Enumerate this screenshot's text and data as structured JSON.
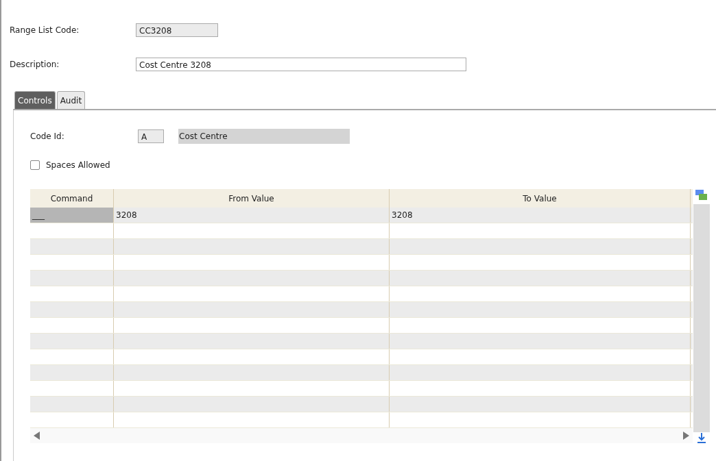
{
  "fields": [
    {
      "label": "Range List Code:",
      "value": "CC3208",
      "kind": "readonly"
    },
    {
      "label": "Description:",
      "value": "Cost Centre 3208",
      "kind": "editable"
    }
  ],
  "tabs": [
    {
      "label": "Controls",
      "selected": true
    },
    {
      "label": "Audit",
      "selected": false
    }
  ],
  "code_id": {
    "label": "Code Id:",
    "value": "A",
    "description": "Cost Centre"
  },
  "spaces_allowed": {
    "label": "Spaces Allowed",
    "checked": false
  },
  "table": {
    "columns": [
      "Command",
      "From Value",
      "To Value"
    ],
    "rows": [
      {
        "cells": [
          "___",
          "3208",
          "3208"
        ],
        "selected": true
      }
    ]
  }
}
